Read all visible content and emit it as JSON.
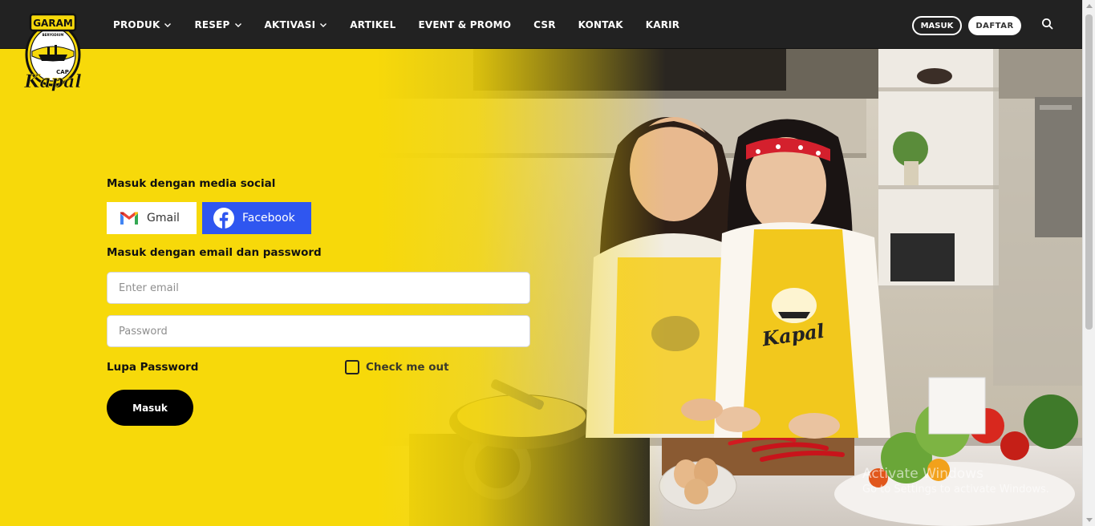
{
  "brand": {
    "top_text": "GARAM",
    "small_text": "BERYODIUM",
    "middle_text": "CAP",
    "bottom_text": "Kapal"
  },
  "nav": {
    "items": [
      {
        "label": "PRODUK",
        "has_dropdown": true
      },
      {
        "label": "RESEP",
        "has_dropdown": true
      },
      {
        "label": "AKTIVASI",
        "has_dropdown": true
      },
      {
        "label": "ARTIKEL",
        "has_dropdown": false
      },
      {
        "label": "EVENT & PROMO",
        "has_dropdown": false
      },
      {
        "label": "CSR",
        "has_dropdown": false
      },
      {
        "label": "KONTAK",
        "has_dropdown": false
      },
      {
        "label": "KARIR",
        "has_dropdown": false
      }
    ],
    "login_label": "MASUK",
    "register_label": "DAFTAR"
  },
  "form": {
    "social_title": "Masuk dengan media social",
    "gmail_label": "Gmail",
    "facebook_label": "Facebook",
    "email_title": "Masuk dengan email dan password",
    "email_placeholder": "Enter email",
    "password_placeholder": "Password",
    "forgot_label": "Lupa Password",
    "check_label": "Check me out",
    "check_checked": false,
    "submit_label": "Masuk"
  },
  "watermark": {
    "line1": "Activate Windows",
    "line2": "Go to Settings to activate Windows."
  },
  "colors": {
    "nav_bg": "#222222",
    "page_yellow": "#f7d90a",
    "facebook_blue": "#2f56f0",
    "button_black": "#000000"
  }
}
